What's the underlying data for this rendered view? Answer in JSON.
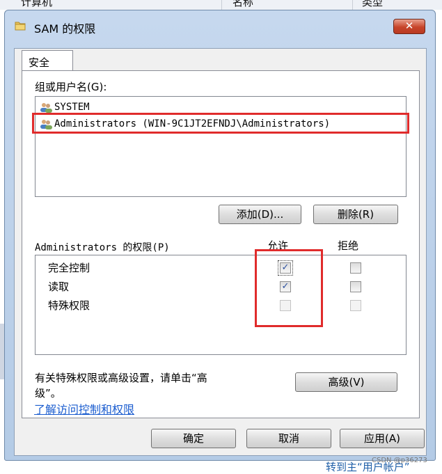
{
  "background": {
    "top_left": "计算机",
    "top_mid": "名称",
    "top_right": "类型",
    "bottom_text": "转到主“用户帐户”",
    "watermark": "CSDN @p36273"
  },
  "dialog": {
    "title": "SAM 的权限",
    "close_glyph": "✕",
    "icon": "folder-icon"
  },
  "tab": {
    "label": "安全"
  },
  "groups": {
    "label": "组或用户名(G):",
    "items": [
      {
        "icon": "users-icon",
        "name": "SYSTEM"
      },
      {
        "icon": "users-icon",
        "name": "Administrators (WIN-9C1JT2EFNDJ\\Administrators)"
      }
    ],
    "add_button": "添加(D)...",
    "remove_button": "删除(R)"
  },
  "permissions": {
    "label": "Administrators 的权限(P)",
    "allow_header": "允许",
    "deny_header": "拒绝",
    "rows": [
      {
        "name": "完全控制",
        "allow": "✓",
        "deny": ""
      },
      {
        "name": "读取",
        "allow": "✓",
        "deny": ""
      },
      {
        "name": "特殊权限",
        "allow": "",
        "deny": ""
      }
    ]
  },
  "advanced": {
    "note_line1": "有关特殊权限或高级设置，请单击“高",
    "note_line2": "级”。",
    "button": "高级(V)"
  },
  "link": "了解访问控制和权限",
  "footer": {
    "ok": "确定",
    "cancel": "取消",
    "apply": "应用(A)"
  },
  "colors": {
    "highlight_red": "#e02b2b",
    "link_blue": "#1a5ccf",
    "title_bar": "#c6d8ee"
  }
}
